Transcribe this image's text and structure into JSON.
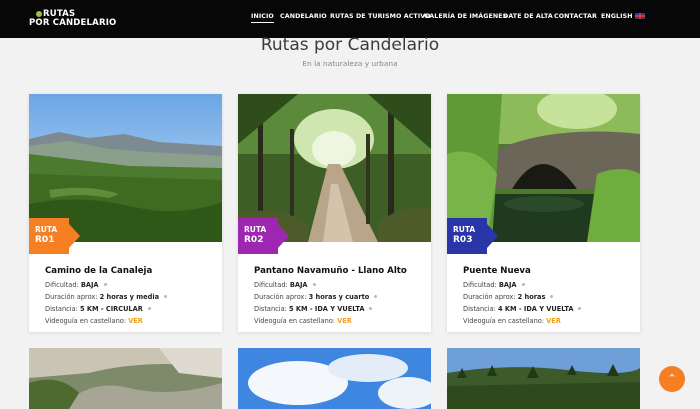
{
  "header": {
    "logo_line1": "RUTAS",
    "logo_line2": "POR CANDELARIO",
    "nav": [
      {
        "label": "INICIO",
        "active": true
      },
      {
        "label": "CANDELARIO",
        "active": false
      },
      {
        "label": "RUTAS DE TURISMO ACTIVO",
        "active": false
      },
      {
        "label": "GALERÍA DE IMÁGENES",
        "active": false
      },
      {
        "label": "DATE DE ALTA",
        "active": false
      },
      {
        "label": "CONTACTAR",
        "active": false
      },
      {
        "label": "ENGLISH",
        "active": false,
        "icon": "uk-flag-icon"
      }
    ]
  },
  "page": {
    "title": "Rutas por Candelario",
    "subtitle": "En la naturaleza y urbana"
  },
  "routes": [
    {
      "badge_word": "RUTA",
      "badge_code": "R01",
      "badge_color": "#f57f22",
      "title": "Camino de la Canaleja",
      "difficulty_label": "Dificultad:",
      "difficulty": "BAJA",
      "duration_label": "Duración aprox:",
      "duration": "2 horas y media",
      "distance_label": "Distancia:",
      "distance": "5 KM - CIRCULAR",
      "video_label": "Videoguía en castellano:",
      "video_link": "VER"
    },
    {
      "badge_word": "RUTA",
      "badge_code": "R02",
      "badge_color": "#9d27b0",
      "title": "Pantano Navamuño - Llano Alto",
      "difficulty_label": "Dificultad:",
      "difficulty": "BAJA",
      "duration_label": "Duración aprox:",
      "duration": "3 horas y cuarto",
      "distance_label": "Distancia:",
      "distance": "5 KM - IDA Y VUELTA",
      "video_label": "Videoguía en castellano:",
      "video_link": "VER"
    },
    {
      "badge_word": "RUTA",
      "badge_code": "R03",
      "badge_color": "#2a35a8",
      "title": "Puente Nueva",
      "difficulty_label": "Dificultad:",
      "difficulty": "BAJA",
      "duration_label": "Duración aprox:",
      "duration": "2 horas",
      "distance_label": "Distancia:",
      "distance": "4 KM - IDA Y VUELTA",
      "video_label": "Videoguía en castellano:",
      "video_link": "VER"
    }
  ],
  "scroll_top_icon": "chevron-up-icon",
  "accent_color": "#f57f22"
}
